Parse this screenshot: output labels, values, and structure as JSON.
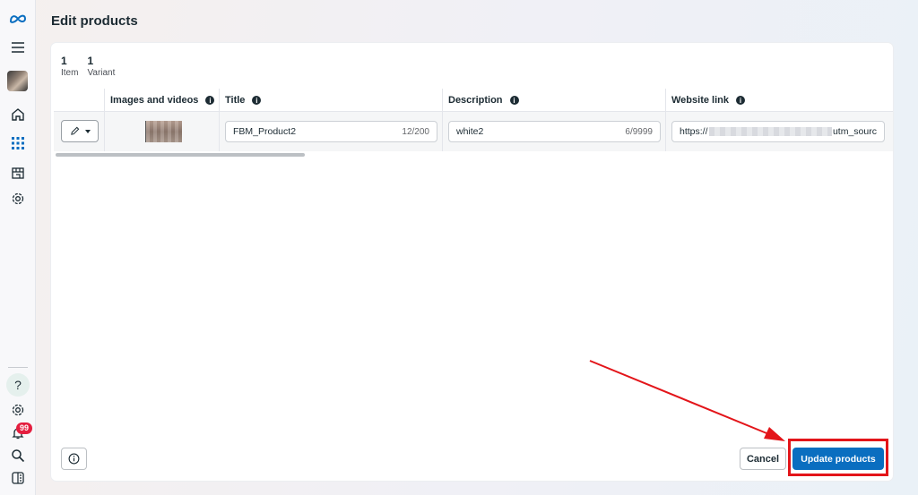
{
  "page": {
    "title": "Edit products"
  },
  "sidebar": {
    "items": [
      {
        "icon": "meta-logo-icon"
      },
      {
        "icon": "menu-icon"
      },
      {
        "icon": "avatar"
      },
      {
        "icon": "home-icon"
      },
      {
        "icon": "grid-apps-icon"
      },
      {
        "icon": "shop-icon"
      },
      {
        "icon": "settings-icon"
      }
    ],
    "bottom": {
      "help_label": "?",
      "notification_count": "99"
    },
    "accent_color": "#0a6ec0"
  },
  "stats": [
    {
      "value": "1",
      "label": "Item"
    },
    {
      "value": "1",
      "label": "Variant"
    }
  ],
  "table": {
    "columns": [
      {
        "label": ""
      },
      {
        "label": "Images and videos"
      },
      {
        "label": "Title"
      },
      {
        "label": "Description"
      },
      {
        "label": "Website link"
      }
    ],
    "rows": [
      {
        "title": "FBM_Product2",
        "title_count": "12/200",
        "description": "white2",
        "description_count": "6/9999",
        "website_prefix": "https://",
        "website_suffix": "utm_sourc"
      }
    ]
  },
  "footer": {
    "cancel_label": "Cancel",
    "update_label": "Update products"
  },
  "annotation": {
    "color": "#e3151a"
  }
}
